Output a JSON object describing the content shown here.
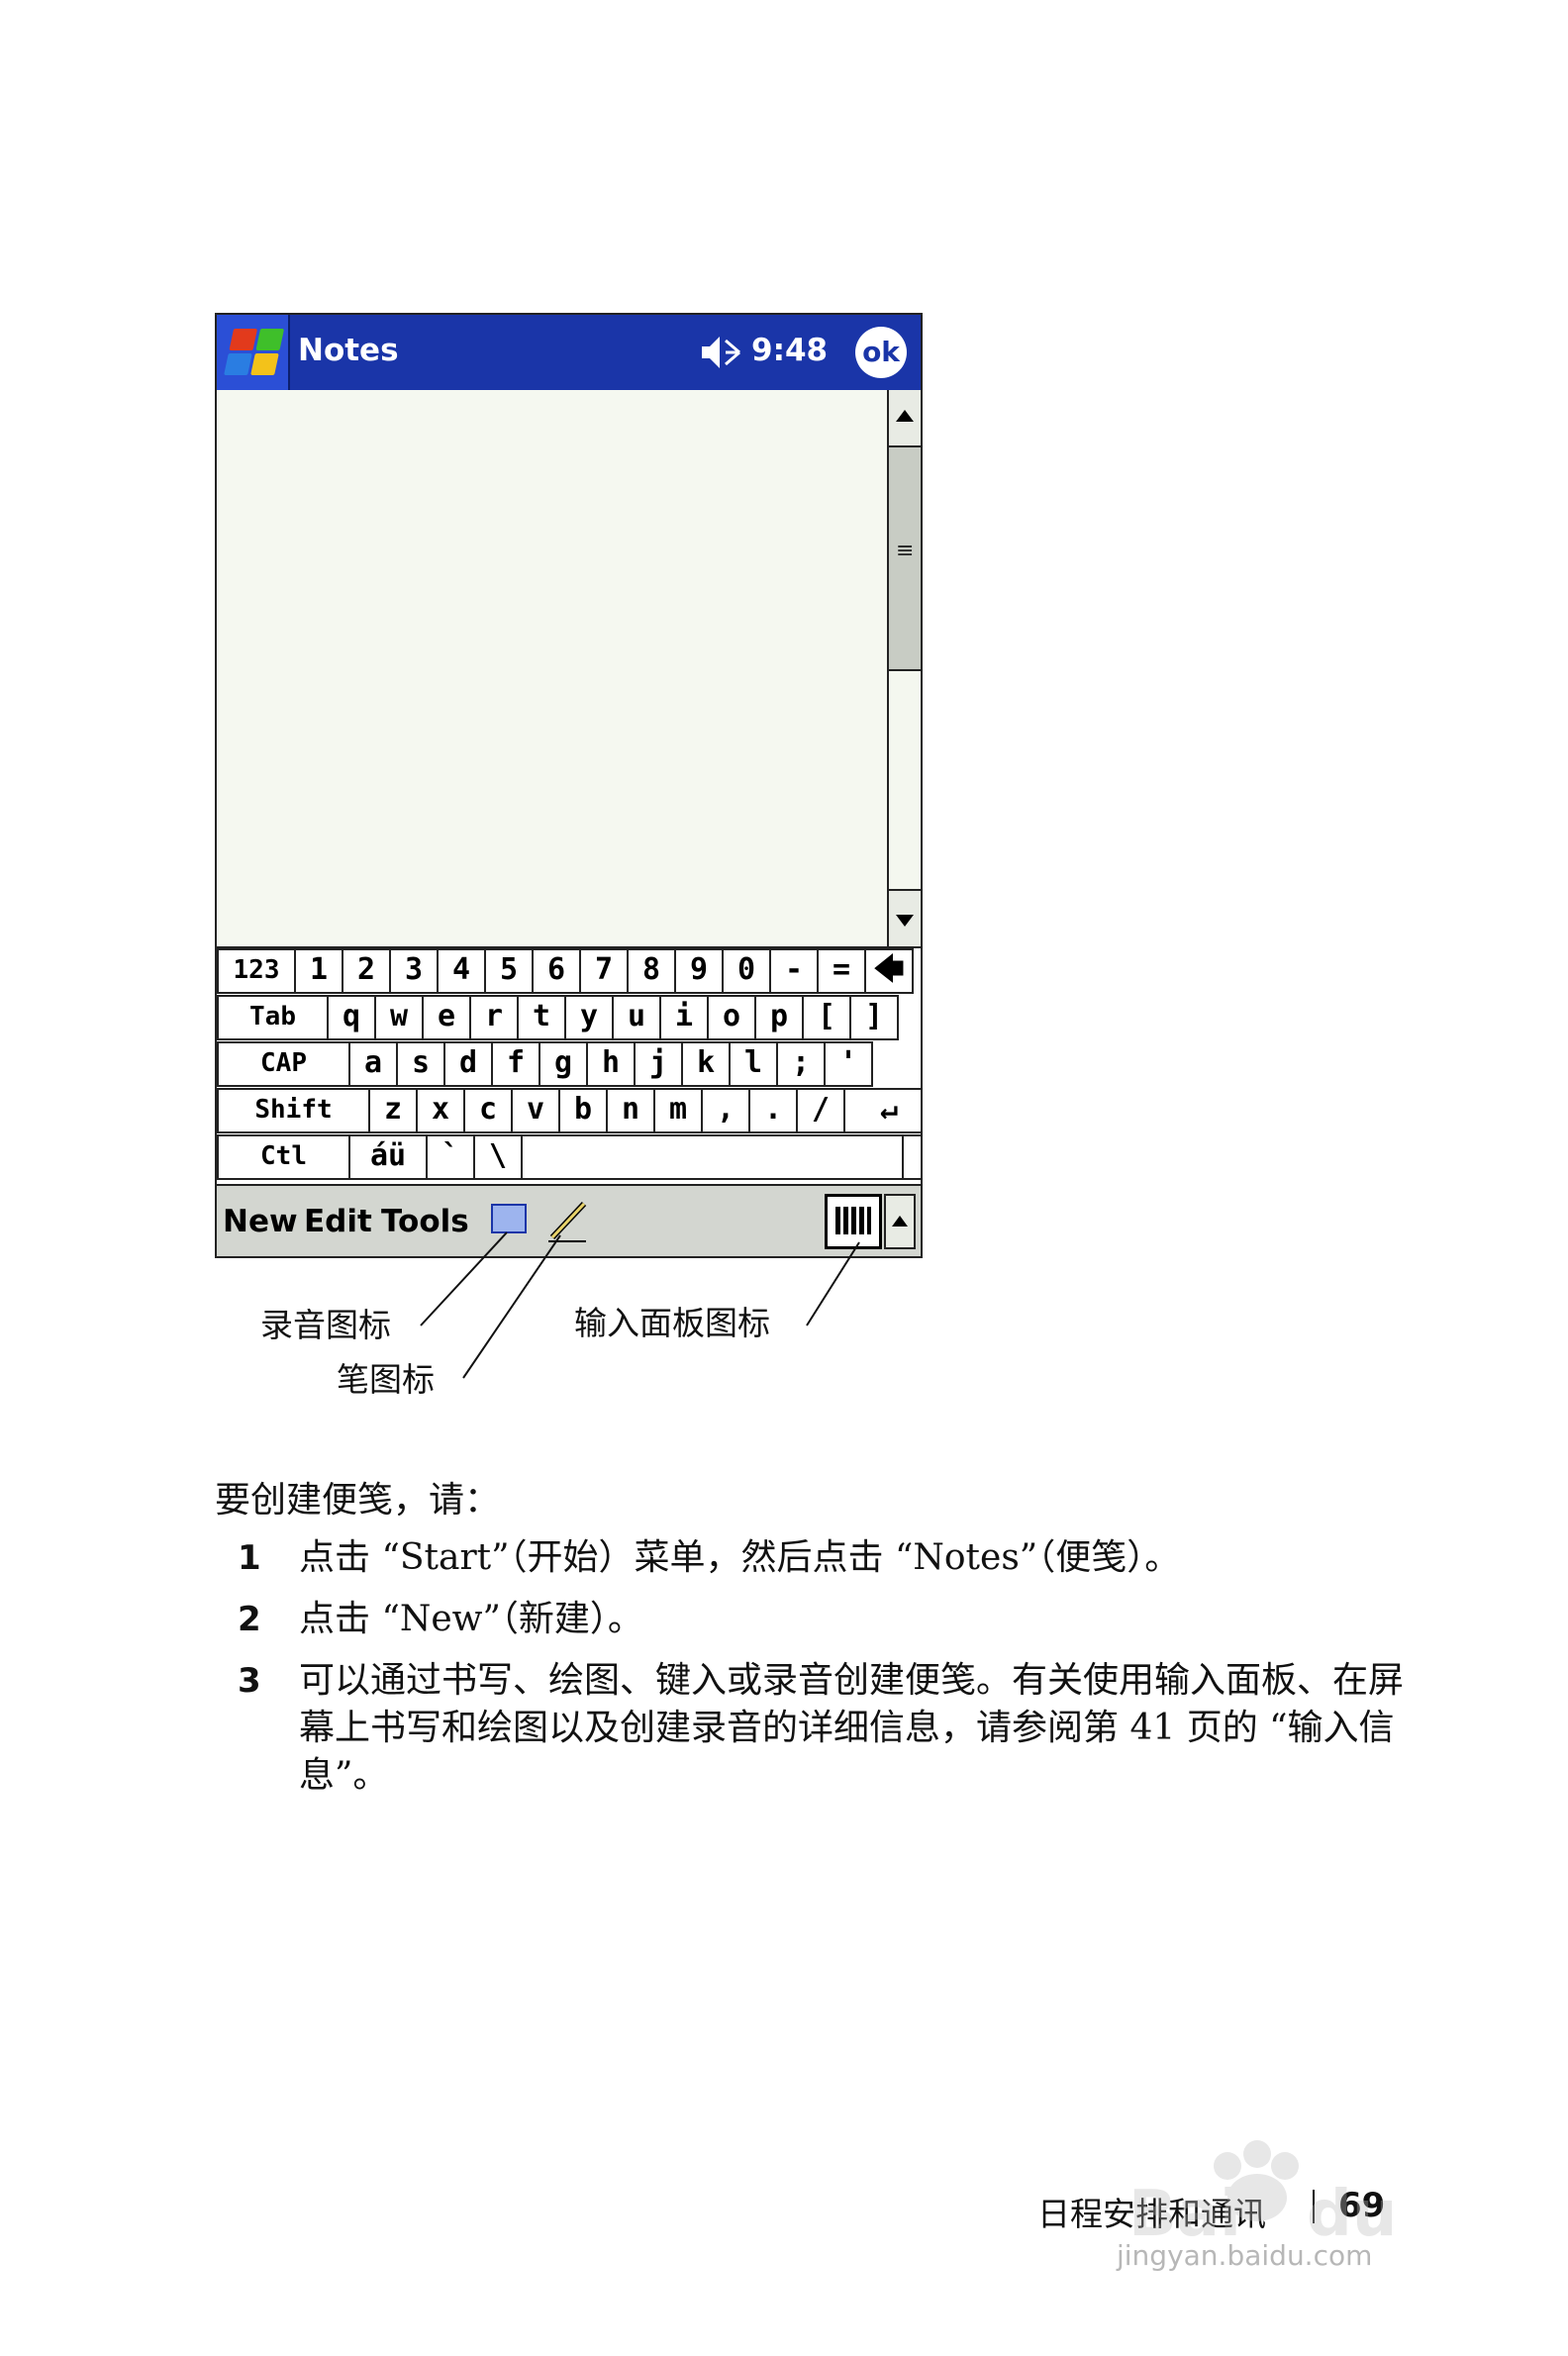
{
  "device": {
    "title": "Notes",
    "time": "9:48",
    "ok_label": "ok",
    "keyboard_rows": [
      [
        "123",
        "1",
        "2",
        "3",
        "4",
        "5",
        "6",
        "7",
        "8",
        "9",
        "0",
        "-",
        "=",
        "🡄"
      ],
      [
        "Tab",
        "q",
        "w",
        "e",
        "r",
        "t",
        "y",
        "u",
        "i",
        "o",
        "p",
        "[",
        "]"
      ],
      [
        "CAP",
        "a",
        "s",
        "d",
        "f",
        "g",
        "h",
        "j",
        "k",
        "l",
        ";",
        "'"
      ],
      [
        "Shift",
        "z",
        "x",
        "c",
        "v",
        "b",
        "n",
        "m",
        ",",
        ".",
        "/",
        "↵"
      ],
      [
        "Ctl",
        "áü",
        "`",
        "\\",
        "",
        "↓",
        "↑",
        "←",
        "→"
      ]
    ],
    "menu": {
      "new": "New",
      "edit": "Edit",
      "tools": "Tools"
    }
  },
  "callouts": {
    "recording_icon": "录音图标",
    "pen_icon": "笔图标",
    "input_panel_icon": "输入面板图标"
  },
  "content": {
    "intro": "要创建便笺，请：",
    "steps": [
      {
        "num": "1",
        "text": "点击 “Start”（开始）菜单，然后点击 “Notes”（便笺）。"
      },
      {
        "num": "2",
        "text": "点击 “New”（新建）。"
      },
      {
        "num": "3",
        "text": "可以通过书写、绘图、键入或录音创建便笺。有关使用输入面板、在屏幕上书写和绘图以及创建录音的详细信息，请参阅第 41 页的 “输入信息”。"
      }
    ]
  },
  "footer": {
    "section": "日程安排和通讯",
    "page": "69"
  },
  "watermark": {
    "text": "jingyan.baidu.com"
  }
}
